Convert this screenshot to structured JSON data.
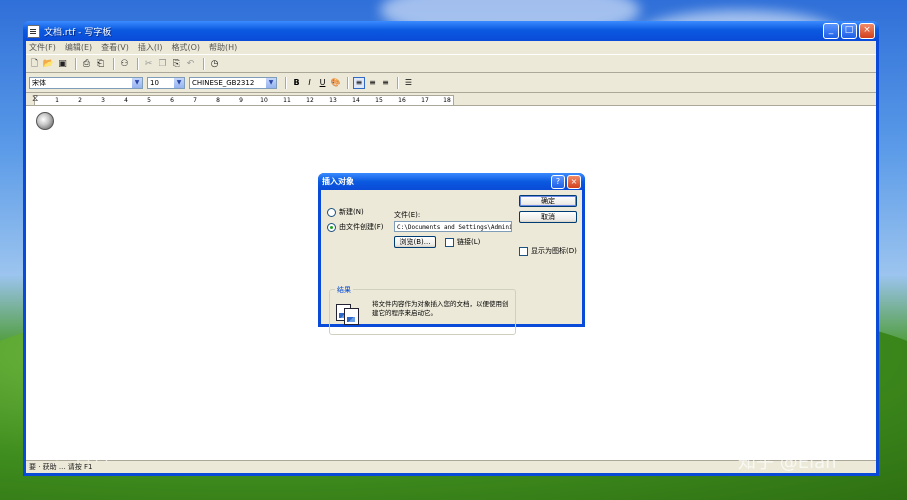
{
  "window": {
    "title": "文档.rtf - 写字板",
    "controls": [
      "_",
      "□",
      "×"
    ]
  },
  "menu": [
    "文件(F)",
    "编辑(E)",
    "查看(V)",
    "插入(I)",
    "格式(O)",
    "帮助(H)"
  ],
  "toolbar_icons": [
    "new-icon",
    "open-icon",
    "save-icon",
    "print-icon",
    "print-preview-icon",
    "find-icon",
    "cut-icon",
    "copy-icon",
    "paste-icon",
    "undo-icon",
    "insert-datetime-icon"
  ],
  "format_bar": {
    "font": "宋体",
    "size": "10",
    "script": "CHINESE_GB2312",
    "bold": "B",
    "italic": "I",
    "underline": "U"
  },
  "ruler": {
    "labels": [
      "1",
      "2",
      "3",
      "4",
      "5",
      "6",
      "7",
      "8",
      "9",
      "10",
      "11",
      "12",
      "13",
      "14",
      "15",
      "16",
      "17",
      "18"
    ]
  },
  "status": {
    "text": "要 · 获助 ... 请按 F1"
  },
  "dialog": {
    "title": "插入对象",
    "help_btn": "?",
    "close_btn": "×",
    "radio_new": "新建(N)",
    "radio_from_file": "由文件创建(F)",
    "file_label": "文件(E):",
    "file_path": "C:\\Documents and Settings\\Admini",
    "browse": "浏览(B)...",
    "link": "链接(L)",
    "ok": "确定",
    "cancel": "取消",
    "display_as_icon": "显示为图标(D)",
    "result_title": "结果",
    "result_text": "将文件内容作为对象插入您的文档，以便使用创建它的程序来启动它。"
  },
  "watermarks": {
    "left": "Bai 百科",
    "right": "知乎 @Elan"
  }
}
